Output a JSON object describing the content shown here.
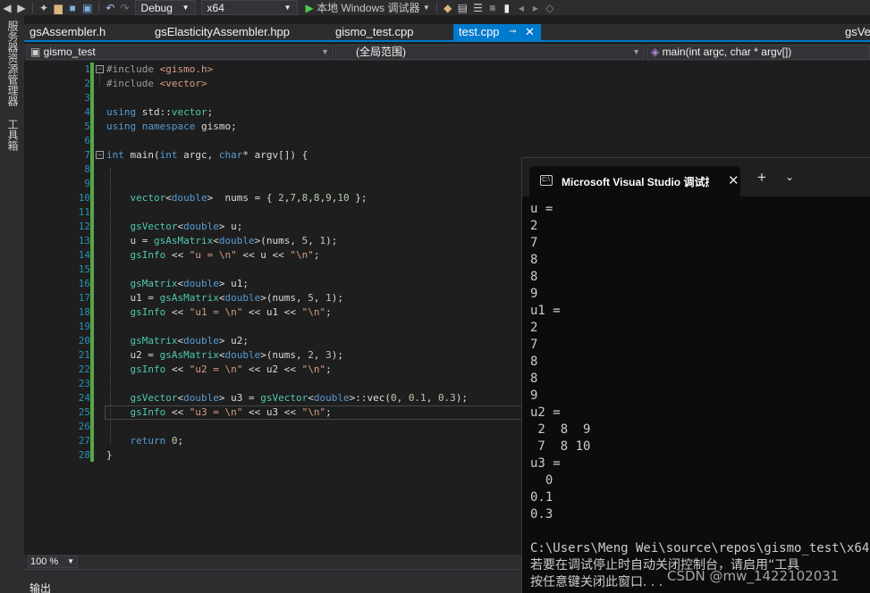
{
  "toolbar": {
    "configuration": "Debug",
    "platform": "x64",
    "run_label": "本地 Windows 调试器"
  },
  "side_tabs": [
    "服务器资源管理器",
    "工具箱"
  ],
  "tabs": [
    {
      "label": "gsAssembler.h",
      "active": false
    },
    {
      "label": "gsElasticityAssembler.hpp",
      "active": false
    },
    {
      "label": "gismo_test.cpp",
      "active": false
    },
    {
      "label": "test.cpp",
      "active": true
    },
    {
      "label": "gsVe",
      "active": false
    }
  ],
  "navbar": {
    "project": "gismo_test",
    "scope": "(全局范围)",
    "member": "main(int argc, char * argv[])"
  },
  "line_numbers": [
    "1",
    "2",
    "3",
    "4",
    "5",
    "6",
    "7",
    "8",
    "9",
    "10",
    "11",
    "12",
    "13",
    "14",
    "15",
    "16",
    "17",
    "18",
    "19",
    "20",
    "21",
    "22",
    "23",
    "24",
    "25",
    "26",
    "27",
    "28"
  ],
  "code_lines": [
    "#include <gismo.h>",
    "#include <vector>",
    "",
    "using std::vector;",
    "using namespace gismo;",
    "",
    "int main(int argc, char* argv[]) {",
    "",
    "",
    "    vector<double>  nums = { 2,7,8,8,9,10 };",
    "",
    "    gsVector<double> u;",
    "    u = gsAsMatrix<double>(nums, 5, 1);",
    "    gsInfo << \"u = \\n\" << u << \"\\n\";",
    "",
    "    gsMatrix<double> u1;",
    "    u1 = gsAsMatrix<double>(nums, 5, 1);",
    "    gsInfo << \"u1 = \\n\" << u1 << \"\\n\";",
    "",
    "    gsMatrix<double> u2;",
    "    u2 = gsAsMatrix<double>(nums, 2, 3);",
    "    gsInfo << \"u2 = \\n\" << u2 << \"\\n\";",
    "",
    "    gsVector<double> u3 = gsVector<double>::vec(0, 0.1, 0.3);",
    "    gsInfo << \"u3 = \\n\" << u3 << \"\\n\";",
    "",
    "    return 0;",
    "}"
  ],
  "zoom": "100 %",
  "output_label": "输出",
  "console": {
    "title": "Microsoft Visual Studio 调试控制台",
    "lines": [
      "u =",
      "2",
      "7",
      "8",
      "8",
      "9",
      "u1 =",
      "2",
      "7",
      "8",
      "8",
      "9",
      "u2 =",
      " 2  8  9",
      " 7  8 10",
      "u3 =",
      "  0",
      "0.1",
      "0.3",
      "",
      "C:\\Users\\Meng Wei\\source\\repos\\gismo_test\\x64"
    ],
    "footer_lines": [
      "若要在调试停止时自动关闭控制台，请启用“工具",
      "按任意键关闭此窗口. . ."
    ]
  },
  "watermark": "CSDN @mw_1422102031"
}
